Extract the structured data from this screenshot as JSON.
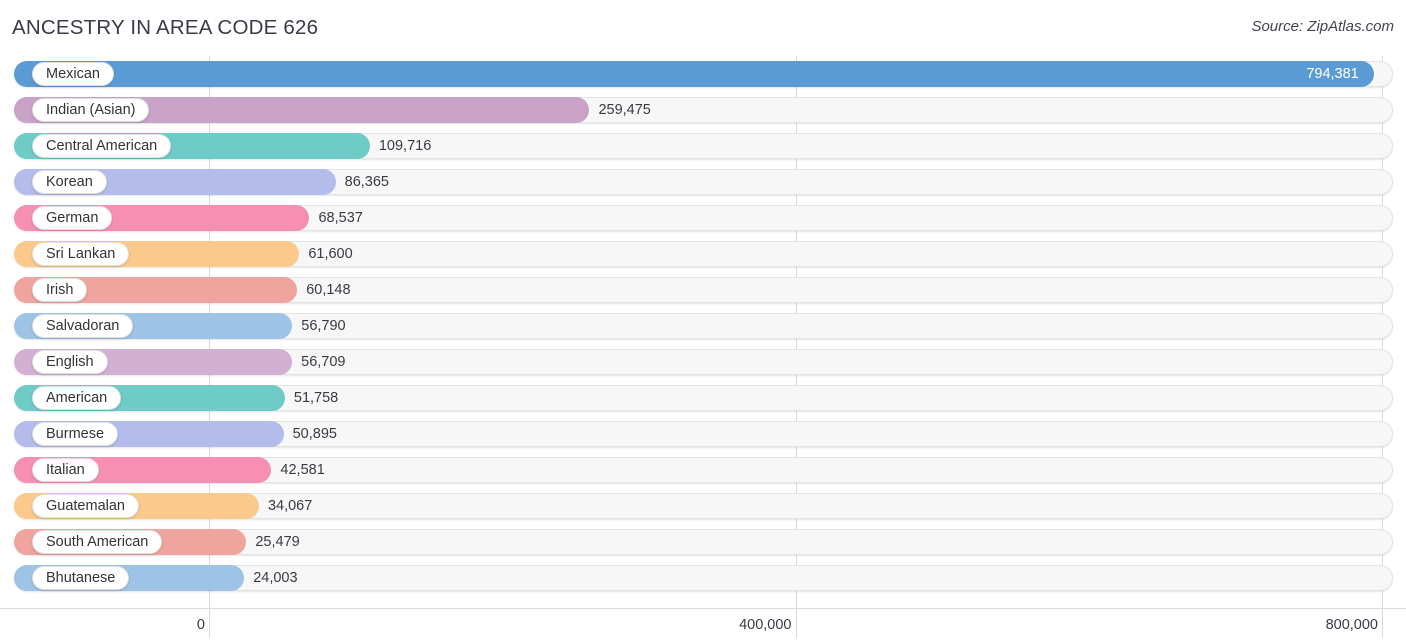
{
  "header": {
    "title": "ANCESTRY IN AREA CODE 626",
    "source": "Source: ZipAtlas.com"
  },
  "axis": {
    "ticks": [
      {
        "label": "0",
        "value": 0
      },
      {
        "label": "400,000",
        "value": 400000
      },
      {
        "label": "800,000",
        "value": 800000
      }
    ],
    "x_min": 0,
    "x_max": 800000
  },
  "palette": {
    "blue": "#5B9BD5",
    "mauve": "#C9A2C8",
    "teal": "#6FCBC8",
    "periwinkle": "#B3BCEA",
    "pink": "#F78FB3",
    "orange": "#FBC98B",
    "salmon": "#EFA49D",
    "light_blue": "#9DC3E6",
    "light_mauve": "#D3B0D3",
    "track_bg": "#F7F7F7",
    "track_border": "#E3E3E3",
    "grid": "#D9D9D9",
    "text": "#3A3A44",
    "inside_text": "#FFFFFF"
  },
  "chart_data": {
    "type": "bar",
    "orientation": "horizontal",
    "title": "ANCESTRY IN AREA CODE 626",
    "subtitle": "",
    "xlabel": "",
    "ylabel": "",
    "xlim": [
      0,
      800000
    ],
    "grid": true,
    "legend": "none",
    "xticks": [
      0,
      400000,
      800000
    ],
    "xtick_labels": [
      "0",
      "400,000",
      "800,000"
    ],
    "categories": [
      "Mexican",
      "Indian (Asian)",
      "Central American",
      "Korean",
      "German",
      "Sri Lankan",
      "Irish",
      "Salvadoran",
      "English",
      "American",
      "Burmese",
      "Italian",
      "Guatemalan",
      "South American",
      "Bhutanese"
    ],
    "values": [
      794381,
      259475,
      109716,
      86365,
      68537,
      61600,
      60148,
      56790,
      56709,
      51758,
      50895,
      42581,
      34067,
      25479,
      24003
    ],
    "value_labels": [
      "794,381",
      "259,475",
      "109,716",
      "86,365",
      "68,537",
      "61,600",
      "60,148",
      "56,790",
      "56,709",
      "51,758",
      "50,895",
      "42,581",
      "34,067",
      "25,479",
      "24,003"
    ],
    "colors": [
      "#5B9BD5",
      "#C9A2C8",
      "#6FCBC8",
      "#B3BCEA",
      "#F78FB3",
      "#FBC98B",
      "#EFA49D",
      "#9DC3E6",
      "#D3B0D3",
      "#6FCBC8",
      "#B3BCEA",
      "#F78FB3",
      "#FBC98B",
      "#EFA49D",
      "#9DC3E6"
    ],
    "label_inside": [
      true,
      false,
      false,
      false,
      false,
      false,
      false,
      false,
      false,
      false,
      false,
      false,
      false,
      false,
      false
    ]
  }
}
